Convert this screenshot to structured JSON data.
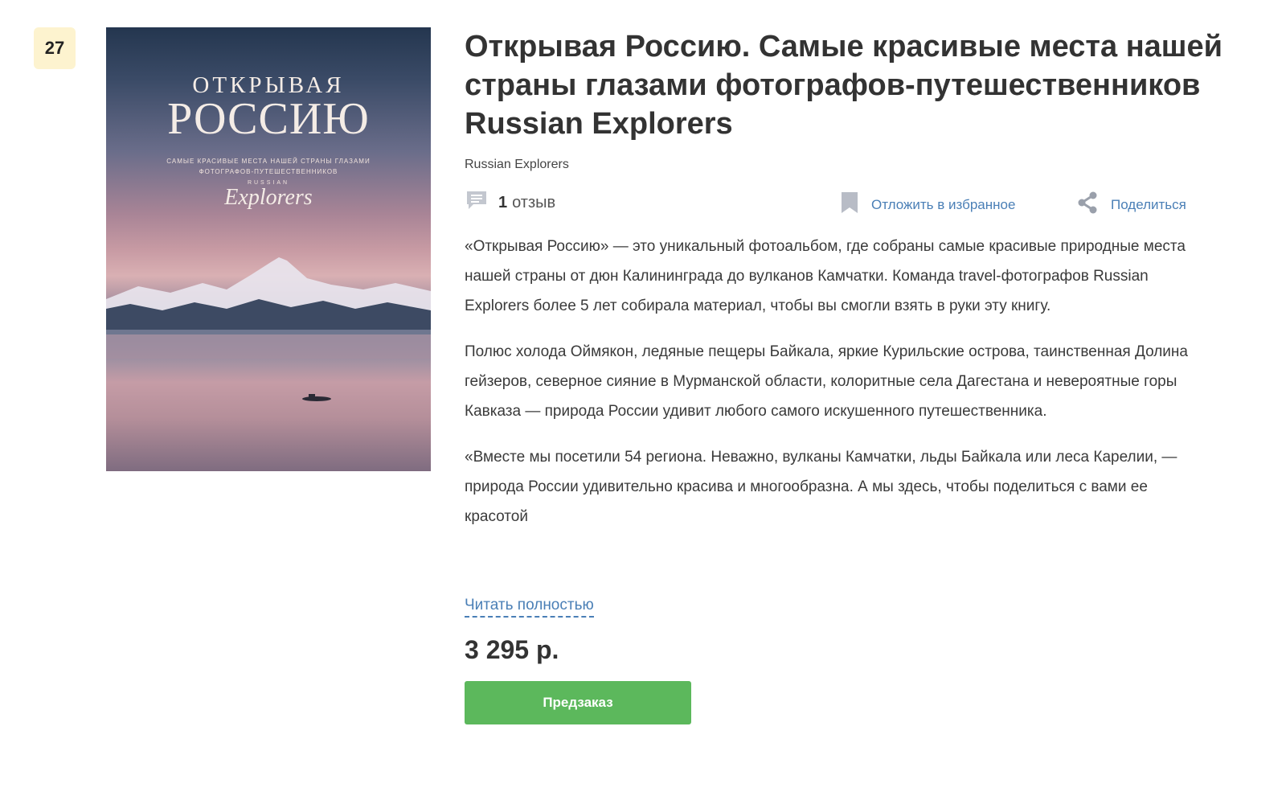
{
  "rank": "27",
  "cover": {
    "line1": "ОТКРЫВАЯ",
    "line2": "РОССИЮ",
    "subtitle": "САМЫЕ КРАСИВЫЕ МЕСТА НАШЕЙ СТРАНЫ ГЛАЗАМИ ФОТОГРАФОВ-ПУТЕШЕСТВЕННИКОВ",
    "brand_small": "RUSSIAN",
    "brand_script": "Explorers"
  },
  "product": {
    "title": "Открывая Россию. Самые красивые места нашей страны глазами фотографов-путешественников Russian Explorers",
    "author": "Russian Explorers",
    "reviews_count": "1",
    "reviews_label": "отзыв",
    "favorite_label": "Отложить в избранное",
    "share_label": "Поделиться",
    "description": [
      "«Открывая Россию» — это уникальный фотоальбом, где собраны самые красивые природные места нашей страны от дюн Калининграда до вулканов Камчатки. Команда travel-фотографов Russian Explorers более 5 лет собирала материал, чтобы вы смогли взять в руки эту книгу.",
      "Полюс холода Оймякон, ледяные пещеры Байкала, яркие Курильские острова, таинственная Долина гейзеров, северное сияние в Мурманской области, колоритные села Дагестана и невероятные горы Кавказа — природа России удивит любого самого искушенного путешественника.",
      "«Вместе мы посетили 54 региона. Неважно, вулканы Камчатки, льды Байкала или леса Карелии, — природа России удивительно красива и многообразна. А мы здесь, чтобы поделиться с вами ее красотой"
    ],
    "read_more_label": "Читать полностью",
    "price": "3 295 р.",
    "order_label": "Предзаказ"
  },
  "colors": {
    "link": "#4a7fb6",
    "button": "#5cb85c",
    "rank_bg": "#fdf3cf"
  },
  "icons": {
    "reviews": "comment-icon",
    "favorite": "bookmark-icon",
    "share": "share-icon"
  }
}
